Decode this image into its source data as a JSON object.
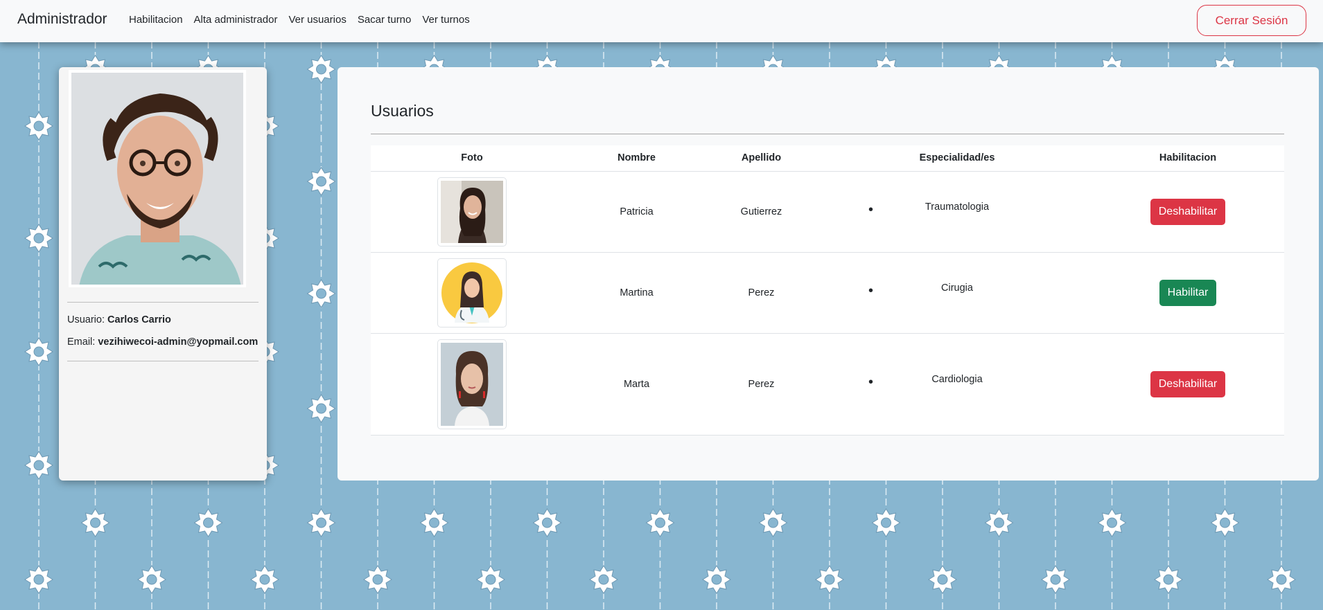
{
  "navbar": {
    "brand": "Administrador",
    "links": [
      "Habilitacion",
      "Alta administrador",
      "Ver usuarios",
      "Sacar turno",
      "Ver turnos"
    ],
    "logout_label": "Cerrar Sesión"
  },
  "profile": {
    "user_label": "Usuario:",
    "user_name": "Carlos Carrio",
    "email_label": "Email:",
    "email": "vezihiwecoi-admin@yopmail.com"
  },
  "users_panel": {
    "title": "Usuarios",
    "columns": [
      "Foto",
      "Nombre",
      "Apellido",
      "Especialidad/es",
      "Habilitacion"
    ],
    "rows": [
      {
        "nombre": "Patricia",
        "apellido": "Gutierrez",
        "especialidad": "Traumatologia",
        "action": "Deshabilitar",
        "action_color": "#dc3545"
      },
      {
        "nombre": "Martina",
        "apellido": "Perez",
        "especialidad": "Cirugia",
        "action": "Habilitar",
        "action_color": "#198754"
      },
      {
        "nombre": "Marta",
        "apellido": "Perez",
        "especialidad": "Cardiologia",
        "action": "Deshabilitar",
        "action_color": "#dc3545"
      }
    ]
  },
  "colors": {
    "background": "#88b6d0",
    "danger": "#dc3545",
    "success": "#198754"
  }
}
